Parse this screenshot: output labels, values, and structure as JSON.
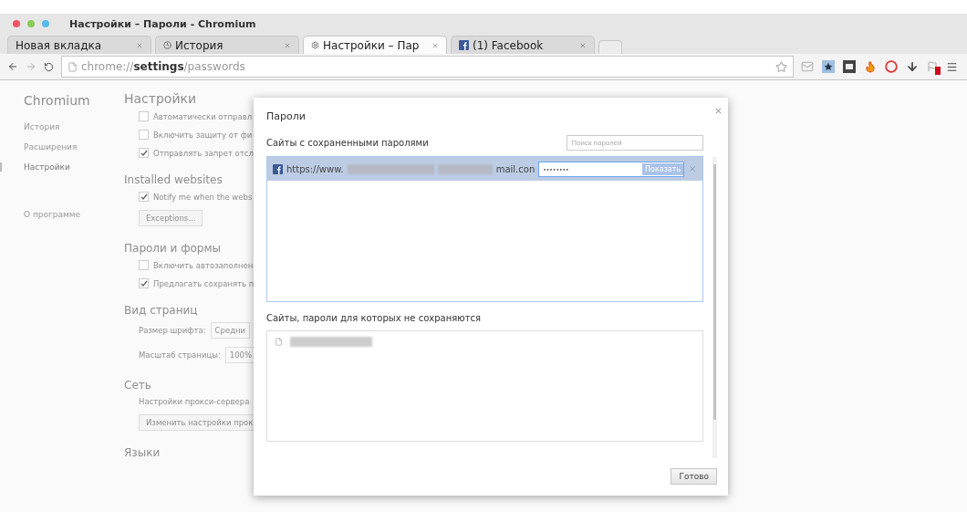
{
  "window": {
    "title": "Настройки – Пароли - Chromium"
  },
  "tabs": [
    {
      "label": "Новая вкладка",
      "kind": "plain",
      "selected": false
    },
    {
      "label": "История",
      "kind": "history",
      "selected": false
    },
    {
      "label": "Настройки – Пар",
      "kind": "settings",
      "selected": true
    },
    {
      "label": "(1) Facebook",
      "kind": "facebook",
      "selected": false
    }
  ],
  "address": {
    "url": "chrome://**settings**/passwords"
  },
  "sidebar": {
    "title": "Chromium",
    "items": [
      {
        "label": "История",
        "selected": false
      },
      {
        "label": "Расширения",
        "selected": false
      },
      {
        "label": "Настройки",
        "selected": true
      },
      {
        "label": "О программе",
        "selected": false
      }
    ]
  },
  "settings": {
    "title": "Настройки",
    "sections": [
      {
        "items": [
          {
            "kind": "checkbox",
            "label": "Автоматически отправл",
            "checked": false
          },
          {
            "kind": "checkbox",
            "label": "Включить защиту от фи",
            "checked": false
          },
          {
            "kind": "checkbox",
            "label": "Отправлять запрет отсл",
            "checked": true
          }
        ]
      },
      {
        "heading": "Installed websites",
        "items": [
          {
            "kind": "checkbox",
            "label": "Notify me when the webs",
            "checked": true
          },
          {
            "kind": "button",
            "label": "Exceptions..."
          }
        ]
      },
      {
        "heading": "Пароли и формы",
        "items": [
          {
            "kind": "checkbox",
            "label": "Включить автозаполнен",
            "checked": false
          },
          {
            "kind": "checkbox",
            "label": "Предлагать сохранять п",
            "checked": true
          }
        ]
      },
      {
        "heading": "Вид страниц",
        "items": [
          {
            "kind": "select",
            "label": "Размер шрифта:",
            "value": "Средни"
          },
          {
            "kind": "select",
            "label": "Масштаб страницы:",
            "value": "100%"
          }
        ]
      },
      {
        "heading": "Сеть",
        "items": [
          {
            "kind": "note",
            "label": "Настройки прокси-сервера"
          },
          {
            "kind": "button",
            "label": "Изменить настройки прок"
          }
        ]
      },
      {
        "heading": "Языки"
      }
    ]
  },
  "dialog": {
    "title": "Пароли",
    "saved": {
      "heading": "Сайты с сохраненными паролями",
      "search_placeholder": "Поиск паролей",
      "rows": [
        {
          "site_start": "https://www.",
          "site_end": "mail.con",
          "redacted": true,
          "password": "••••••••",
          "show_button": "Показать",
          "selected": true
        }
      ]
    },
    "excluded": {
      "heading": "Сайты, пароли для которых не сохраняются",
      "rows": [
        {
          "redacted": true
        }
      ]
    },
    "done_button": "Готово"
  }
}
